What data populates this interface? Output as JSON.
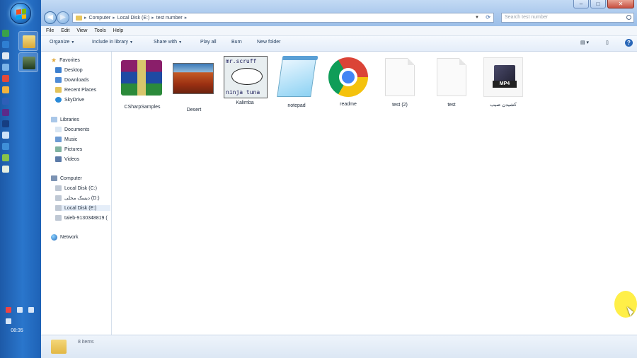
{
  "taskbar": {
    "clock": "08:35"
  },
  "explorer": {
    "address": {
      "segments": [
        "Computer",
        "Local Disk (E:)",
        "test number"
      ]
    },
    "search": {
      "placeholder": "Search test number"
    },
    "menu": [
      "File",
      "Edit",
      "View",
      "Tools",
      "Help"
    ],
    "toolbar": {
      "organize": "Organize",
      "include_in_library": "Include in library",
      "share_with": "Share with",
      "play_all": "Play all",
      "burn": "Burn",
      "new_folder": "New folder"
    },
    "navigation": {
      "favorites_header": "Favorites",
      "favorites": [
        "Desktop",
        "Downloads",
        "Recent Places",
        "SkyDrive"
      ],
      "libraries_header": "Libraries",
      "libraries": [
        "Documents",
        "Music",
        "Pictures",
        "Videos"
      ],
      "computer_header": "Computer",
      "drives": [
        "Local Disk (C:)",
        "دیسک محلی (D:)",
        "Local Disk (E:)",
        "taleb-9130348819 ("
      ],
      "network": "Network"
    },
    "files": [
      {
        "name": "CSharpSamples",
        "icon": "winrar-archive-icon"
      },
      {
        "name": "Desert",
        "icon": "desert-image-icon"
      },
      {
        "name": "Kalimba",
        "icon": "kalimba-thumbnail-icon"
      },
      {
        "name": "notepad",
        "icon": "notepad-icon"
      },
      {
        "name": "readme",
        "icon": "chrome-icon"
      },
      {
        "name": "test (2)",
        "icon": "blank-document-icon"
      },
      {
        "name": "test",
        "icon": "blank-document-icon"
      },
      {
        "name": "کشیدن صیب",
        "icon": "mp4-video-icon"
      }
    ],
    "status": {
      "item_count": "8 items"
    },
    "thumbnail_texts": {
      "kalimba_top": "mr.scruff",
      "kalimba_bottom": "ninja tuna",
      "mp4_tag": "MP4"
    }
  }
}
